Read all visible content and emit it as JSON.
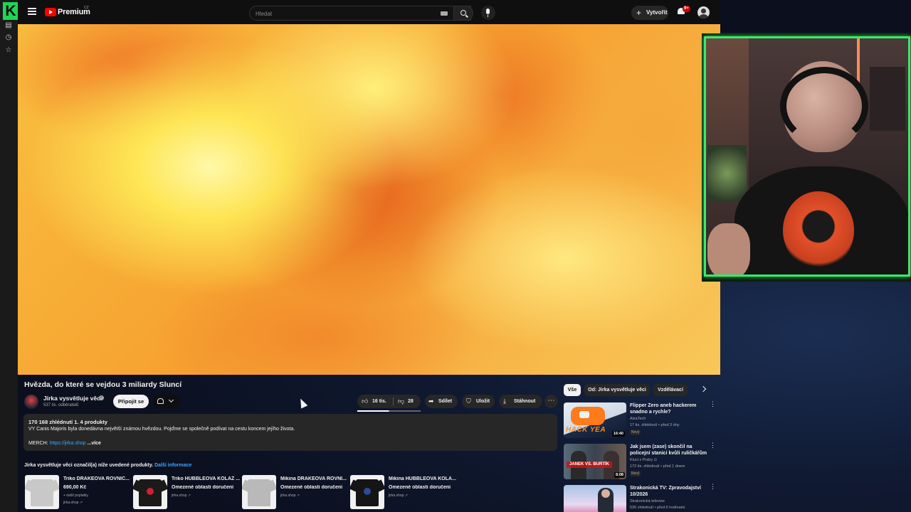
{
  "brand": {
    "premium_label": "Premium",
    "country_code": "CZ",
    "k_logo": "K",
    "accent": "#3be86b"
  },
  "search": {
    "placeholder": "Hledat"
  },
  "header": {
    "create_label": "Vytvořit",
    "notif_count": "9+"
  },
  "video": {
    "title": "Hvězda, do které se vejdou 3 miliardy Sluncí",
    "channel": "Jirka vysvětluje věci",
    "subscribers": "537 tis. odběratelů",
    "join_label": "Připojit se",
    "likes": "16 tis.",
    "dislikes": "28",
    "share_label": "Sdílet",
    "save_label": "Uložit",
    "download_label": "Stáhnout"
  },
  "description": {
    "views_line": "170 168 zhlédnutí  1.  4 produkty",
    "text": "VY Canis Majoris byla donedávna největší známou hvězdou. Pojďme se společně podívat na cestu koncem jejího života.",
    "merch_prefix": "MERCH: ",
    "merch_link": "https://jirka.shop",
    "more_label": "...více"
  },
  "products": {
    "heading": "Jirka vysvětluje věci označil(a) níže uvedené produkty.",
    "more_info": "Další informace",
    "items": [
      {
        "name": "Triko DRAKEOVA ROVNIC...",
        "line2": "690,00 Kč",
        "line3": "+ další poplatky",
        "shop": "jirka.shop ↗"
      },
      {
        "name": "Triko HUBBLEOVA KOLÁŽ ...",
        "line2": "Omezené oblasti doručení",
        "line3": "",
        "shop": "jirka.shop ↗"
      },
      {
        "name": "Mikina DRAKEOVA ROVNI...",
        "line2": "Omezené oblasti doručení",
        "line3": "",
        "shop": "jirka.shop ↗"
      },
      {
        "name": "Mikina HUBBLEOVA KOLÁ...",
        "line2": "Omezené oblasti doručení",
        "line3": "",
        "shop": "jirka.shop ↗"
      }
    ]
  },
  "chips": {
    "all": "Vše",
    "channel": "Od: Jirka vysvětluje věci",
    "edu": "Vzdělávací"
  },
  "recommendations": [
    {
      "title": "Flipper Zero aneb hackerem snadno a rychle?",
      "channel": "AlzaTech",
      "meta": "17 tis. zhlédnutí • před 3 dny",
      "badge": "Nový",
      "duration": "16:40",
      "thumb_text": "HACK YEA"
    },
    {
      "title": "Jak jsem (zase) skončil na policejní stanici kvůli ruličkářům",
      "channel": "Kluci z Prahy ⊙",
      "meta": "172 tis. zhlédnutí • před 1 dnem",
      "badge": "Nový",
      "duration": "8:08",
      "thumb_text": "JANEK VS. BURTÍK"
    },
    {
      "title": "Strakonická TV: Zpravodajství 10/2026",
      "channel": "Strakonická televize",
      "meta": "536 zhlédnutí • před 6 hodinami",
      "badge": "",
      "duration": "",
      "thumb_text": ""
    }
  ],
  "icons": [
    "menu-icon",
    "youtube-logo-icon",
    "search-icon",
    "mic-icon",
    "plus-icon",
    "bell-icon",
    "avatar",
    "like-icon",
    "dislike-icon",
    "share-icon",
    "save-icon",
    "download-icon",
    "more-icon",
    "chevron-right-icon"
  ]
}
